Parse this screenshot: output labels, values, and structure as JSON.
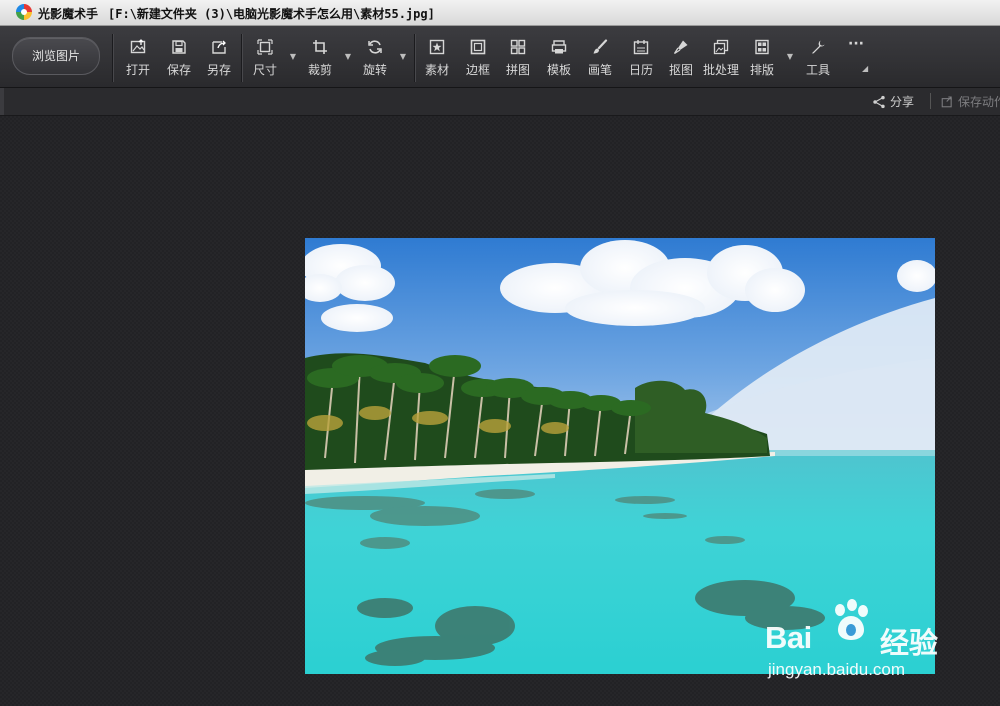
{
  "window": {
    "app_name": "光影魔术手",
    "file_path": "[F:\\新建文件夹 (3)\\电脑光影魔术手怎么用\\素材55.jpg]"
  },
  "toolbar": {
    "browse_label": "浏览图片",
    "tools": {
      "open": "打开",
      "save": "保存",
      "save_as": "另存",
      "size": "尺寸",
      "crop": "裁剪",
      "rotate": "旋转",
      "material": "素材",
      "border": "边框",
      "collage": "拼图",
      "template": "模板",
      "brush": "画笔",
      "calendar": "日历",
      "cutout": "抠图",
      "batch": "批处理",
      "layout": "排版",
      "tools": "工具"
    },
    "more_label": "···"
  },
  "subbar": {
    "share_label": "分享",
    "save_action_label": "保存动作"
  },
  "watermark": {
    "brand": "Bai",
    "brand_cn": "经验",
    "url": "jingyan.baidu.com"
  },
  "colors": {
    "toolbar_bg": "#2f2f33",
    "canvas_bg": "#222225",
    "sky": "#3d86d6",
    "water": "#3fd3d6"
  },
  "icons": {
    "open": "open-image-icon",
    "save": "save-icon",
    "save_as": "save-as-icon",
    "size": "resize-icon",
    "crop": "crop-icon",
    "rotate": "rotate-icon",
    "material": "star-frame-icon",
    "border": "frame-icon",
    "collage": "grid-icon",
    "template": "template-icon",
    "brush": "brush-icon",
    "calendar": "calendar-icon",
    "cutout": "pen-icon",
    "batch": "stack-icon",
    "layout": "layout-icon",
    "tools": "wrench-icon",
    "share": "share-icon"
  }
}
